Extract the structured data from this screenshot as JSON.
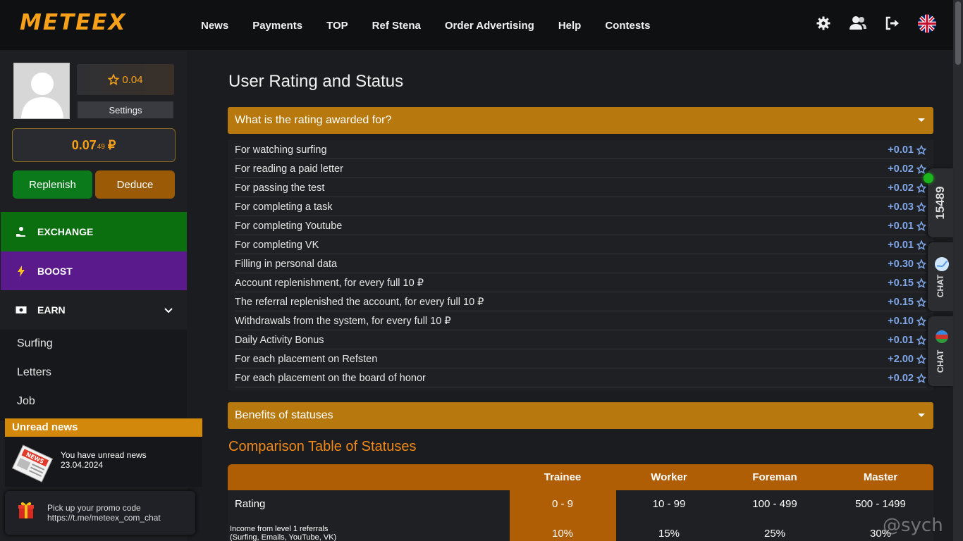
{
  "header": {
    "logo": "METEEX",
    "nav": [
      "News",
      "Payments",
      "TOP",
      "Ref Stena",
      "Order Advertising",
      "Help",
      "Contests"
    ],
    "icons": [
      "settings-gear-icon",
      "users-icon",
      "logout-icon",
      "uk-flag-icon"
    ]
  },
  "profile": {
    "rating": "0.04",
    "settings_label": "Settings",
    "balance_main": "0.07",
    "balance_small": "49",
    "currency": "₽",
    "replenish_label": "Replenish",
    "deduce_label": "Deduce"
  },
  "sidebar": {
    "exchange_label": "EXCHANGE",
    "boost_label": "BOOST",
    "earn_label": "EARN",
    "sub_items": [
      "Surfing",
      "Letters",
      "Job"
    ]
  },
  "news": {
    "title": "Unread news",
    "text": "You have unread news",
    "date": "23.04.2024"
  },
  "promo": {
    "line1": "Pick up your promo code",
    "line2": "https://t.me/meteex_com_chat"
  },
  "main": {
    "title": "User Rating and Status",
    "accordion1": "What is the rating awarded for?",
    "accordion2": "Benefits of statuses",
    "rules": [
      {
        "label": "For watching surfing",
        "value": "+0.01"
      },
      {
        "label": "For reading a paid letter",
        "value": "+0.02"
      },
      {
        "label": "For passing the test",
        "value": "+0.02"
      },
      {
        "label": "For completing a task",
        "value": "+0.03"
      },
      {
        "label": "For completing Youtube",
        "value": "+0.01"
      },
      {
        "label": "For completing VK",
        "value": "+0.01"
      },
      {
        "label": "Filling in personal data",
        "value": "+0.30"
      },
      {
        "label": "Account replenishment, for every full 10 ₽",
        "value": "+0.15"
      },
      {
        "label": "The referral replenished the account, for every full 10 ₽",
        "value": "+0.15"
      },
      {
        "label": "Withdrawals from the system, for every full 10 ₽",
        "value": "+0.10"
      },
      {
        "label": "Daily Activity Bonus",
        "value": "+0.01"
      },
      {
        "label": "For each placement on Refsten",
        "value": "+2.00"
      },
      {
        "label": "For each placement on the board of honor",
        "value": "+0.02"
      }
    ],
    "comparison_title": "Comparison Table of Statuses",
    "table": {
      "headers": [
        "Trainee",
        "Worker",
        "Foreman",
        "Master"
      ],
      "rating_label": "Rating",
      "rating_values": [
        "0 - 9",
        "10 - 99",
        "100 - 499",
        "500 - 1499"
      ],
      "income_label_1": "Income from level 1 referrals",
      "income_label_2": "(Surfing, Emails, YouTube, VK)",
      "income_values": [
        "10%",
        "15%",
        "25%",
        "30%"
      ]
    }
  },
  "side_tabs": {
    "online_count": "15489",
    "chat1": "CHAT",
    "chat2": "CHAT"
  },
  "watermark": "@sych",
  "colors": {
    "accent_orange": "#f7a11a",
    "accordion": "#b7790e",
    "exchange_green": "#0b6f10",
    "boost_purple": "#5b1a8c",
    "value_blue": "#7fa6e8"
  }
}
